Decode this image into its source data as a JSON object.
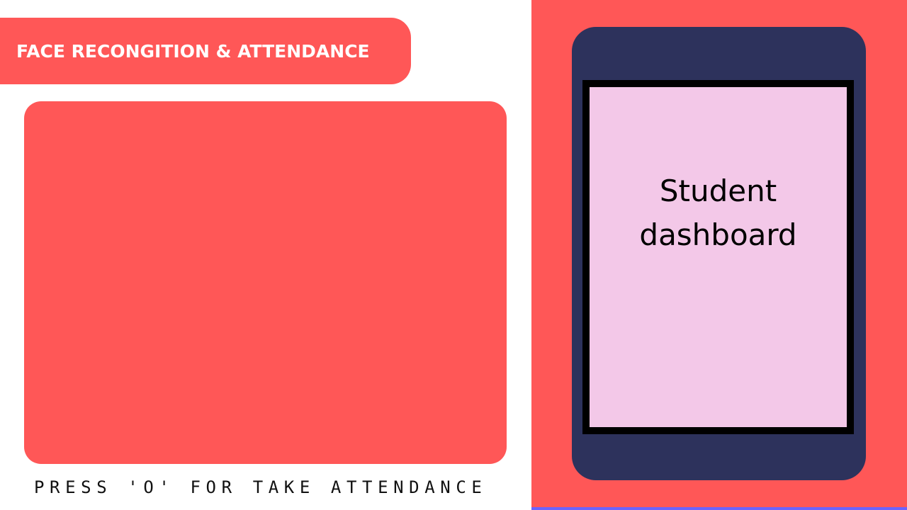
{
  "header": {
    "title": "FACE RECONGITION & ATTENDANCE"
  },
  "camera": {
    "hint": "PRESS 'O' FOR TAKE ATTENDANCE"
  },
  "device": {
    "screen_label": "Student dashboard"
  },
  "colors": {
    "accent": "#ff5757",
    "device_body": "#2d325c",
    "screen": "#f3c8e8",
    "highlight": "#6b63ff",
    "background": "#ffffff"
  }
}
